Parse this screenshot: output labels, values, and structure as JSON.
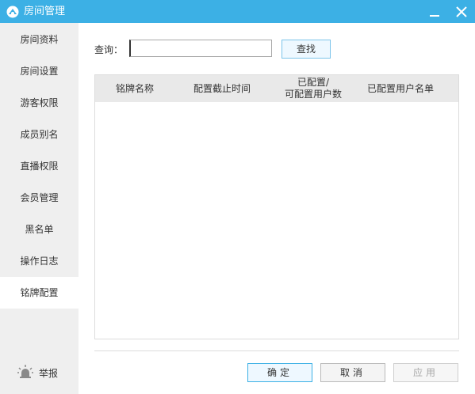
{
  "window": {
    "title": "房间管理",
    "accent": "#3cb0e5"
  },
  "sidebar": {
    "items": [
      {
        "label": "房间资料"
      },
      {
        "label": "房间设置"
      },
      {
        "label": "游客权限"
      },
      {
        "label": "成员别名"
      },
      {
        "label": "直播权限"
      },
      {
        "label": "会员管理"
      },
      {
        "label": "黑名单"
      },
      {
        "label": "操作日志"
      },
      {
        "label": "铭牌配置",
        "active": true
      }
    ],
    "report_label": "举报"
  },
  "search": {
    "label": "查询：",
    "value": "",
    "button_label": "查找"
  },
  "table": {
    "columns": [
      "铭牌名称",
      "配置截止时间",
      "已配置/",
      "可配置用户数",
      "已配置用户名单"
    ],
    "rows": []
  },
  "footer": {
    "ok_label": "确定",
    "cancel_label": "取消",
    "apply_label": "应用"
  }
}
